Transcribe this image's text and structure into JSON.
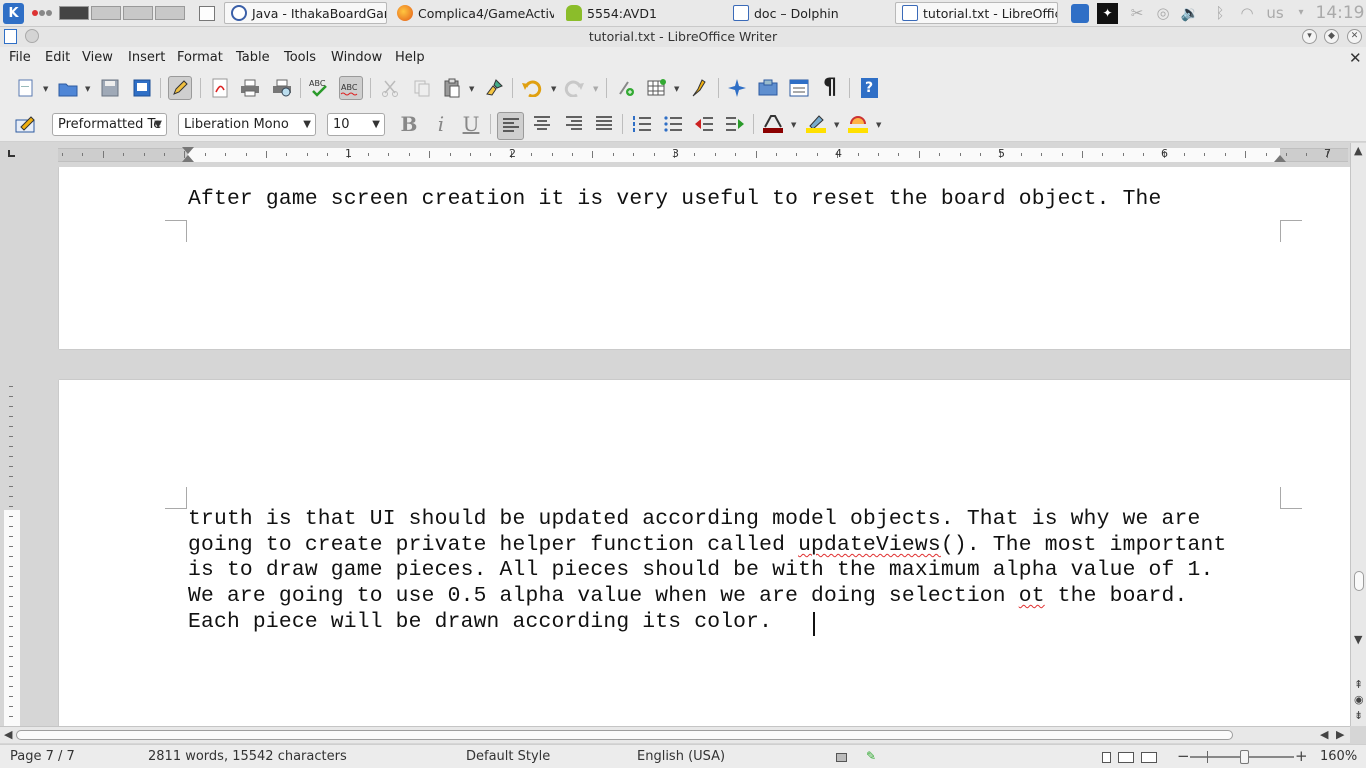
{
  "taskbar": {
    "tasks": [
      {
        "label": "Java - IthakaBoardGam"
      },
      {
        "label": "Complica4/GameActivi"
      },
      {
        "label": "5554:AVD1"
      },
      {
        "label": "doc – Dolphin"
      },
      {
        "label": "tutorial.txt - LibreOffic"
      }
    ],
    "keyboard_layout": "us",
    "clock": "14:19"
  },
  "window": {
    "title": "tutorial.txt - LibreOffice Writer"
  },
  "menu": [
    "File",
    "Edit",
    "View",
    "Insert",
    "Format",
    "Table",
    "Tools",
    "Window",
    "Help"
  ],
  "format_bar": {
    "paragraph_style": "Preformatted Te",
    "font_name": "Liberation Mono",
    "font_size": "10"
  },
  "ruler": {
    "numbers": [
      "1",
      "2",
      "3",
      "4",
      "5",
      "6",
      "7"
    ]
  },
  "document": {
    "page1_lines": [
      "After game screen creation it is very useful to reset the board object. The"
    ],
    "page2": {
      "line1": "truth is that UI should be updated according model objects. That is why we are",
      "line2_before": "going to create private helper function called ",
      "line2_misspelled": "updateViews",
      "line2_after": "(). The most important",
      "line3": "is to draw game pieces. All pieces should be with the maximum alpha value of 1.",
      "line4_before": "We are going to use 0.5 alpha value when we are doing selection ",
      "line4_misspelled": "ot",
      "line4_after": " the board.",
      "line5": "Each piece will be drawn according its color. "
    }
  },
  "status": {
    "page": "Page 7 / 7",
    "counts": "2811 words, 15542 characters",
    "page_style": "Default Style",
    "language": "English (USA)",
    "zoom": "160%"
  },
  "colors": {
    "accent_blue": "#2f6fc6",
    "spellcheck_red": "#e03030"
  }
}
